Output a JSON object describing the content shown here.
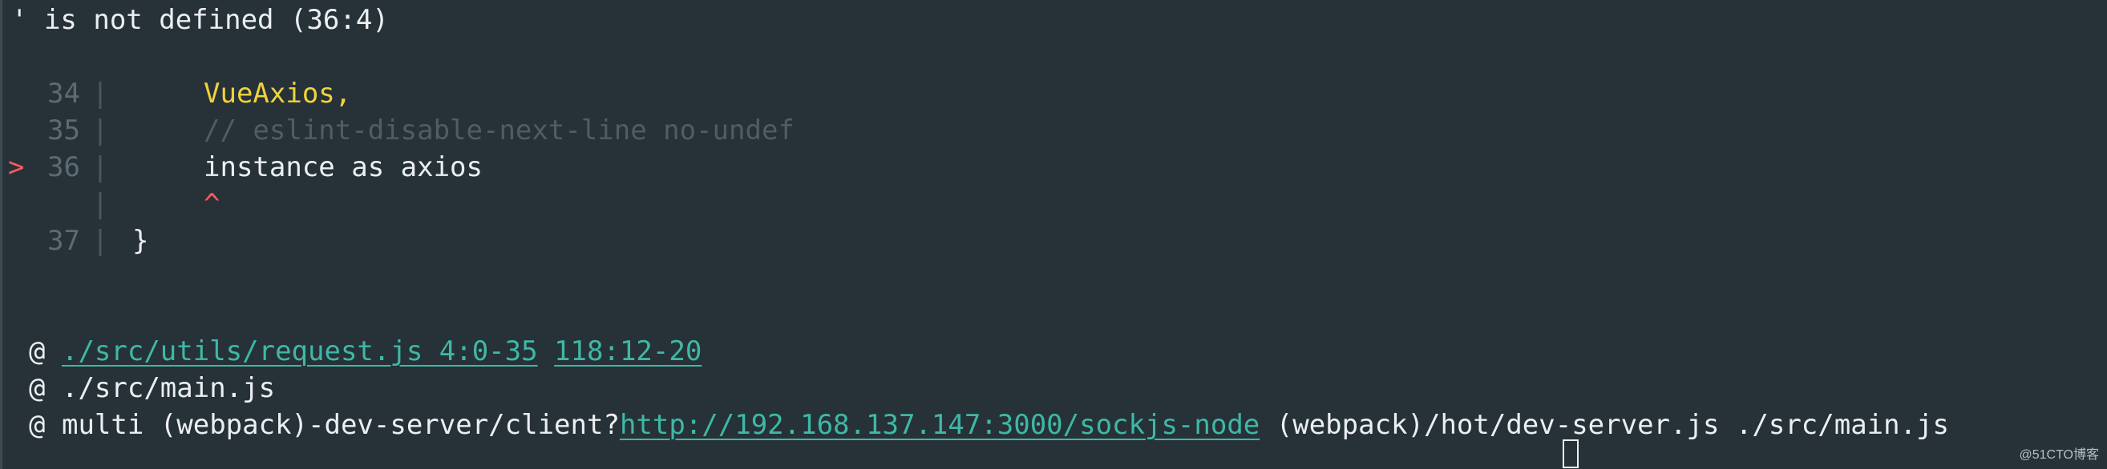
{
  "error": {
    "message": "' is not defined (36:4)"
  },
  "code_frame": {
    "lines": [
      {
        "number": "34",
        "marker": "",
        "code": "VueAxios,",
        "style": "yellow"
      },
      {
        "number": "35",
        "marker": "",
        "code": "// eslint-disable-next-line no-undef",
        "style": "comment"
      },
      {
        "number": "36",
        "marker": ">",
        "code": "instance as axios",
        "style": "white"
      },
      {
        "number": "",
        "marker": "",
        "code": "^",
        "style": "caret"
      },
      {
        "number": "37",
        "marker": "",
        "code": "}",
        "style": "white"
      }
    ],
    "gutter_char": "|"
  },
  "stack": {
    "at_symbol": "@",
    "entries": [
      {
        "link1": "./src/utils/request.js 4:0-35",
        "link2": "118:12-20"
      },
      {
        "text": "./src/main.js"
      },
      {
        "prefix": "multi (webpack)-dev-server/client?",
        "link": "http://192.168.137.147:3000/sockjs-node",
        "suffix": " (webpack)/hot/dev-server.js ./src/main.js"
      }
    ]
  },
  "watermark": "@51CTO博客",
  "colors": {
    "background": "#263238",
    "arrow": "#ff5a5f",
    "keyword_yellow": "#f0d33b",
    "comment": "#4f5d64",
    "link": "#3fb8a6"
  }
}
